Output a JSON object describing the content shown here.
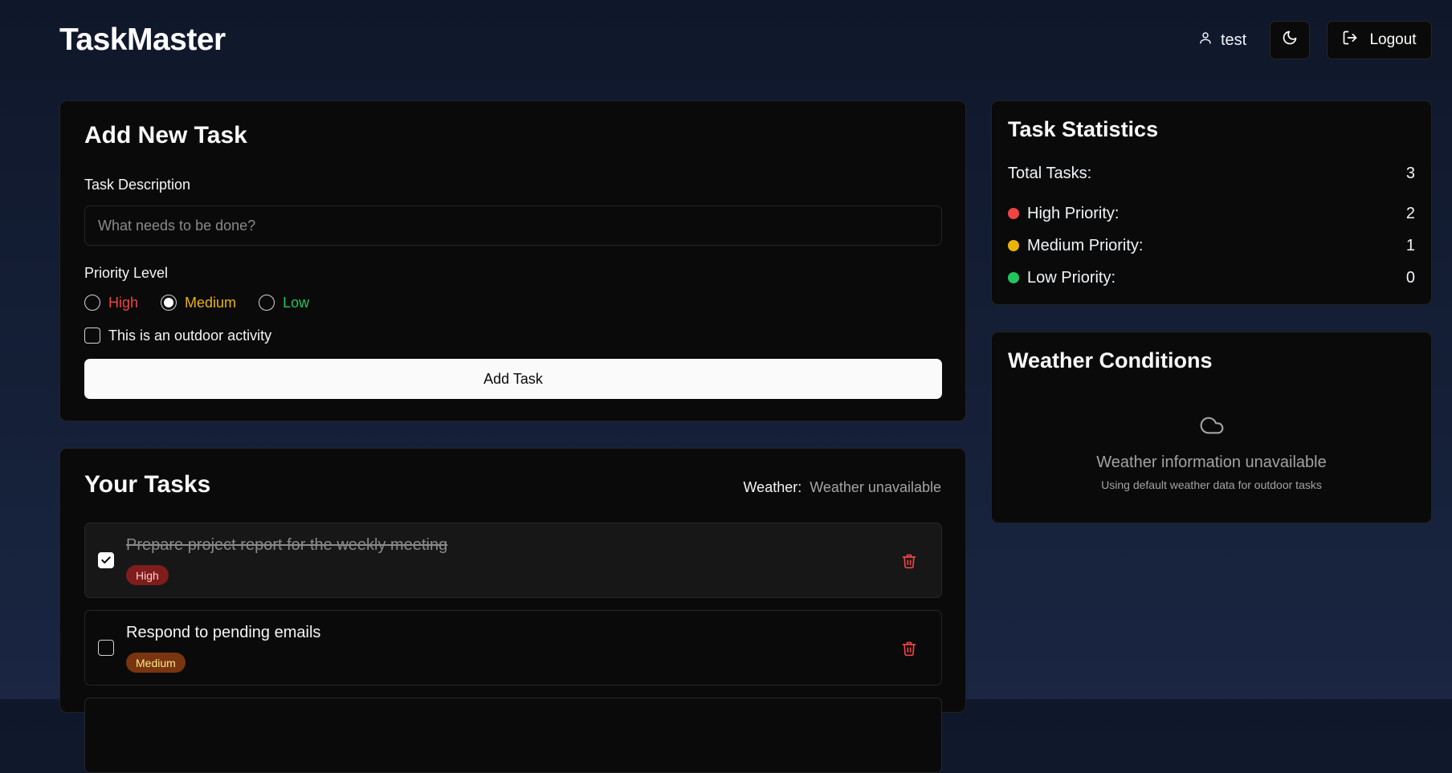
{
  "header": {
    "brand": "TaskMaster",
    "username": "test",
    "logout_label": "Logout"
  },
  "add_task": {
    "title": "Add New Task",
    "description_label": "Task Description",
    "description_placeholder": "What needs to be done?",
    "description_value": "",
    "priority_label": "Priority Level",
    "priorities": [
      {
        "label": "High",
        "color": "#ef4444",
        "selected": false
      },
      {
        "label": "Medium",
        "color": "#eab308",
        "selected": true
      },
      {
        "label": "Low",
        "color": "#22c55e",
        "selected": false
      }
    ],
    "outdoor_label": "This is an outdoor activity",
    "outdoor_checked": false,
    "submit_label": "Add Task"
  },
  "tasks": {
    "title": "Your Tasks",
    "weather_key": "Weather:",
    "weather_value": "Weather unavailable",
    "items": [
      {
        "text": "Prepare project report for the weekly meeting",
        "priority": "High",
        "done": true
      },
      {
        "text": "Respond to pending emails",
        "priority": "Medium",
        "done": false
      }
    ]
  },
  "stats": {
    "title": "Task Statistics",
    "total_label": "Total Tasks:",
    "total_value": "3",
    "rows": [
      {
        "label": "High Priority:",
        "value": "2",
        "color": "#ef4444"
      },
      {
        "label": "Medium Priority:",
        "value": "1",
        "color": "#eab308"
      },
      {
        "label": "Low Priority:",
        "value": "0",
        "color": "#22c55e"
      }
    ]
  },
  "weather": {
    "title": "Weather Conditions",
    "icon": "cloud-icon",
    "main": "Weather information unavailable",
    "sub": "Using default weather data for outdoor tasks"
  },
  "icons": {
    "user": "user-icon",
    "theme": "moon-icon",
    "logout": "logout-icon",
    "delete": "trash-icon",
    "check": "check-icon"
  }
}
